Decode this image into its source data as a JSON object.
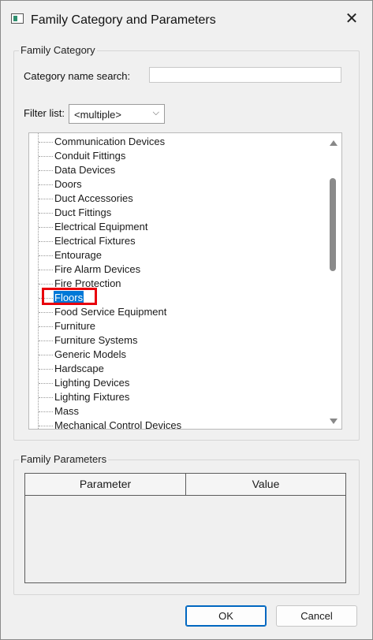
{
  "window": {
    "title": "Family Category and Parameters",
    "icon": "family-window-icon",
    "close_glyph": "✕"
  },
  "family_category": {
    "group_label": "Family Category",
    "search_label": "Category name search:",
    "search_value": "",
    "filter_label": "Filter list:",
    "filter_value": "<multiple>",
    "categories": [
      "Communication Devices",
      "Conduit Fittings",
      "Data Devices",
      "Doors",
      "Duct Accessories",
      "Duct Fittings",
      "Electrical Equipment",
      "Electrical Fixtures",
      "Entourage",
      "Fire Alarm Devices",
      "Fire Protection",
      "Floors",
      "Food Service Equipment",
      "Furniture",
      "Furniture Systems",
      "Generic Models",
      "Hardscape",
      "Lighting Devices",
      "Lighting Fixtures",
      "Mass",
      "Mechanical Control Devices"
    ],
    "selected": "Floors",
    "highlight_color": "#e8000c",
    "selection_color": "#0078d7"
  },
  "family_parameters": {
    "group_label": "Family Parameters",
    "columns": [
      "Parameter",
      "Value"
    ]
  },
  "buttons": {
    "ok": "OK",
    "cancel": "Cancel"
  }
}
